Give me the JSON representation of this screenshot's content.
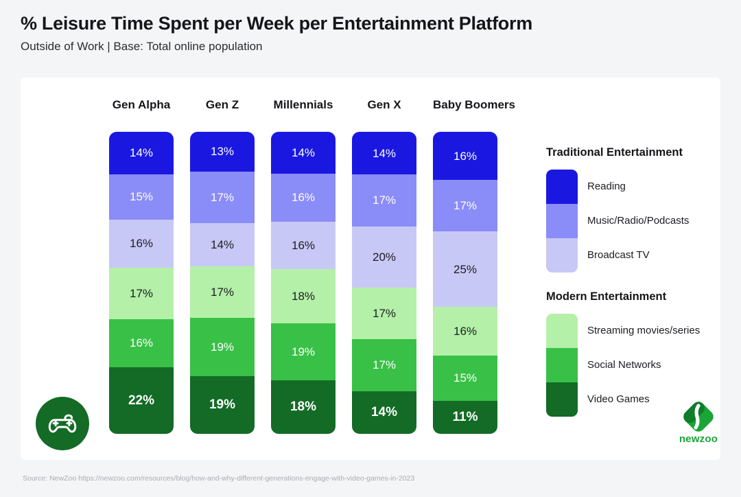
{
  "header": {
    "title": "% Leisure Time Spent per Week per Entertainment Platform",
    "subtitle": "Outside of Work |  Base: Total online population"
  },
  "footer": {
    "source": "Source: NewZoo https://newzoo.com/resources/blog/how-and-why-different-generations-engage-with-video-games-in-2023"
  },
  "branding": {
    "logo_text": "newzoo",
    "logo_mark_name": "newzoo-diamond-mark",
    "badge_icon_name": "gamepad-icon"
  },
  "legend": {
    "groups": [
      {
        "heading": "Traditional Entertainment",
        "items": [
          {
            "label": "Reading",
            "color": "#1a18e0"
          },
          {
            "label": "Music/Radio/Podcasts",
            "color": "#8a8cf8"
          },
          {
            "label": "Broadcast TV",
            "color": "#c8c8f6"
          }
        ]
      },
      {
        "heading": "Modern Entertainment",
        "items": [
          {
            "label": "Streaming movies/series",
            "color": "#b4f0a8"
          },
          {
            "label": "Social Networks",
            "color": "#39c047"
          },
          {
            "label": "Video Games",
            "color": "#136b26"
          }
        ]
      }
    ]
  },
  "chart_data": {
    "type": "bar",
    "subtype": "stacked-bar-100",
    "title": "% Leisure Time Spent per Week per Entertainment Platform",
    "subtitle": "Outside of Work |  Base: Total online population",
    "xlabel": "",
    "ylabel": "",
    "ylim": [
      0,
      100
    ],
    "grid": false,
    "legend_position": "right",
    "value_suffix": "%",
    "categories": [
      "Gen Alpha",
      "Gen Z",
      "Millennials",
      "Gen X",
      "Baby Boomers"
    ],
    "series": [
      {
        "name": "Reading",
        "color": "#1a18e0",
        "label_color": "light",
        "values": [
          14,
          13,
          14,
          14,
          16
        ]
      },
      {
        "name": "Music/Radio/Podcasts",
        "color": "#8a8cf8",
        "label_color": "light",
        "values": [
          15,
          17,
          16,
          17,
          17
        ]
      },
      {
        "name": "Broadcast TV",
        "color": "#c8c8f6",
        "label_color": "dark",
        "values": [
          16,
          14,
          16,
          20,
          25
        ]
      },
      {
        "name": "Streaming movies/series",
        "color": "#b4f0a8",
        "label_color": "dark",
        "values": [
          17,
          17,
          18,
          17,
          16
        ]
      },
      {
        "name": "Social Networks",
        "color": "#39c047",
        "label_color": "light",
        "values": [
          16,
          19,
          19,
          17,
          15
        ]
      },
      {
        "name": "Video Games",
        "color": "#136b26",
        "label_color": "light",
        "values": [
          22,
          19,
          18,
          14,
          11
        ],
        "emphasis": true
      }
    ],
    "labels": {
      "Gen Alpha": [
        "14%",
        "15%",
        "16%",
        "17%",
        "16%",
        "22%"
      ],
      "Gen Z": [
        "13%",
        "17%",
        "14%",
        "17%",
        "19%",
        "19%"
      ],
      "Millennials": [
        "14%",
        "16%",
        "16%",
        "18%",
        "19%",
        "18%"
      ],
      "Gen X": [
        "14%",
        "17%",
        "20%",
        "17%",
        "17%",
        "14%"
      ],
      "Baby Boomers": [
        "16%",
        "17%",
        "25%",
        "16%",
        "15%",
        "11%"
      ]
    }
  }
}
